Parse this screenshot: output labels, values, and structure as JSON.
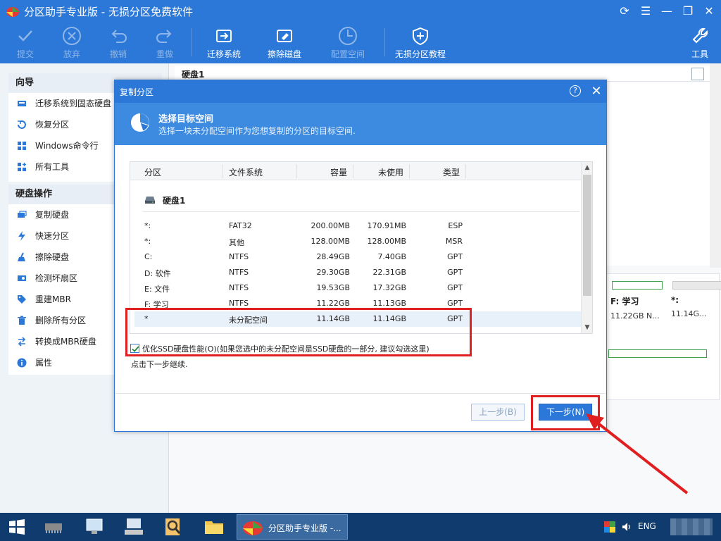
{
  "window": {
    "title": "分区助手专业版 - 无损分区免费软件",
    "controls": [
      "refresh",
      "menu",
      "minimize",
      "restore",
      "close"
    ]
  },
  "toolbar": {
    "commit": "提交",
    "discard": "放弃",
    "undo": "撤销",
    "redo": "重做",
    "migrate": "迁移系统",
    "wipe": "擦除磁盘",
    "alloc": "配置空间",
    "tutorial": "无损分区教程",
    "tools": "工具"
  },
  "sidebar": {
    "wizard_title": "向导",
    "wizard_items": [
      "迁移系统到固态硬盘",
      "恢复分区",
      "Windows命令行",
      "所有工具"
    ],
    "disk_ops_title": "硬盘操作",
    "disk_ops_items": [
      "复制硬盘",
      "快速分区",
      "擦除硬盘",
      "检测坏扇区",
      "重建MBR",
      "删除所有分区",
      "转换成MBR硬盘",
      "属性"
    ]
  },
  "main": {
    "disk_header": "硬盘1",
    "cards": [
      {
        "name": "F: 学习",
        "size": "11.22GB N..."
      },
      {
        "name": "*:",
        "size": "11.14G..."
      }
    ]
  },
  "dialog": {
    "title": "复制分区",
    "help": "?",
    "banner_title": "选择目标空间",
    "banner_subtitle": "选择一块未分配空间作为您想复制的分区的目标空间.",
    "columns": {
      "partition": "分区",
      "fs": "文件系统",
      "capacity": "容量",
      "free": "未使用",
      "type": "类型"
    },
    "disk_label": "硬盘1",
    "rows": [
      {
        "name": "*:",
        "fs": "FAT32",
        "capacity": "200.00MB",
        "free": "170.91MB",
        "type": "ESP"
      },
      {
        "name": "*:",
        "fs": "其他",
        "capacity": "128.00MB",
        "free": "128.00MB",
        "type": "MSR"
      },
      {
        "name": "C:",
        "fs": "NTFS",
        "capacity": "28.49GB",
        "free": "7.40GB",
        "type": "GPT"
      },
      {
        "name": "D: 软件",
        "fs": "NTFS",
        "capacity": "29.30GB",
        "free": "22.31GB",
        "type": "GPT"
      },
      {
        "name": "E: 文件",
        "fs": "NTFS",
        "capacity": "19.53GB",
        "free": "17.32GB",
        "type": "GPT"
      },
      {
        "name": "F: 学习",
        "fs": "NTFS",
        "capacity": "11.22GB",
        "free": "11.13GB",
        "type": "GPT"
      },
      {
        "name": "*",
        "fs": "未分配空间",
        "capacity": "11.14GB",
        "free": "11.14GB",
        "type": "GPT"
      }
    ],
    "ssd_checkbox_label": "优化SSD硬盘性能(O)(如果您选中的未分配空间是SSD硬盘的一部分, 建议勾选这里)",
    "ssd_checked": true,
    "hint": "点击下一步继续.",
    "prev_button": "上一步(B)",
    "next_button": "下一步(N)"
  },
  "taskbar": {
    "active_task": "分区助手专业版 -...",
    "lang": "ENG"
  },
  "colors": {
    "accent": "#2b78d8",
    "annotation": "#e02020",
    "taskbar": "#0f3b6e"
  }
}
